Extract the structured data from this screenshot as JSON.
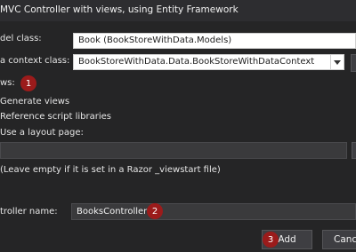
{
  "window": {
    "title": "MVC Controller with views, using Entity Framework"
  },
  "model_class": {
    "label": "del class:",
    "value": "Book (BookStoreWithData.Models)"
  },
  "data_context": {
    "label": "a context class:",
    "value": "BookStoreWithData.Data.BookStoreWithDataContext"
  },
  "views": {
    "label": "ws:",
    "badge": "1",
    "generate_views": "Generate views",
    "reference_scripts": "Reference script libraries",
    "use_layout": "Use a layout page:",
    "layout_value": "",
    "layout_hint": "(Leave empty if it is set in a Razor _viewstart file)"
  },
  "controller": {
    "label": "troller name:",
    "value": "BooksController",
    "badge": "2"
  },
  "buttons": {
    "add_badge": "3",
    "add": "Add",
    "cancel": "Cance"
  },
  "colors": {
    "badge": "#9b1b1b",
    "window_bg": "#252526"
  }
}
